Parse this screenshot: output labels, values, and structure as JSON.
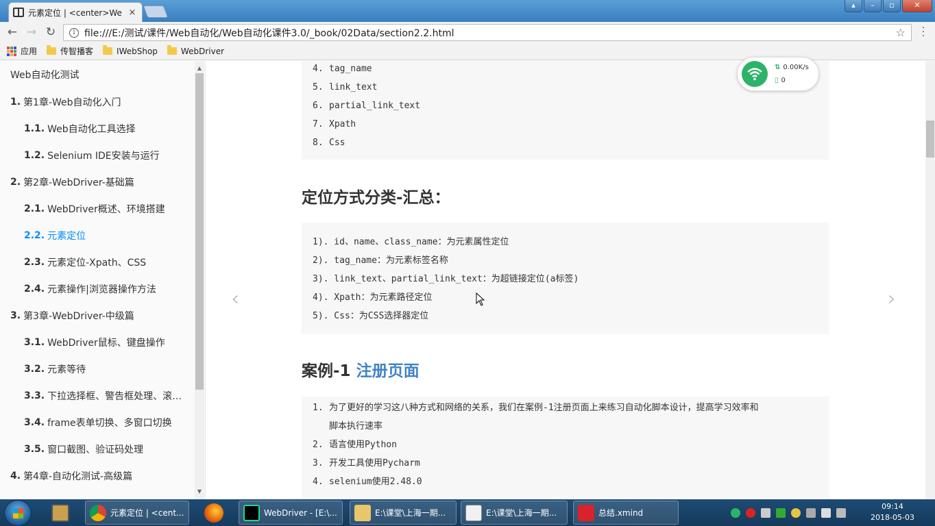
{
  "browser": {
    "tab_title": "元素定位 | <center>We",
    "url": "file:///E:/测试/课件/Web自动化/Web自动化课件3.0/_book/02Data/section2.2.html",
    "bookmarks": [
      "应用",
      "传智播客",
      "IWebShop",
      "WebDriver"
    ],
    "tab_close": "×"
  },
  "sidebar": {
    "book_title": "Web自动化测试",
    "items": [
      {
        "num": "1.",
        "label": "第1章-Web自动化入门",
        "level": 1
      },
      {
        "num": "1.1.",
        "label": "Web自动化工具选择",
        "level": 2
      },
      {
        "num": "1.2.",
        "label": "Selenium IDE安装与运行",
        "level": 2
      },
      {
        "num": "2.",
        "label": "第2章-WebDriver-基础篇",
        "level": 1
      },
      {
        "num": "2.1.",
        "label": "WebDriver概述、环境搭建",
        "level": 2
      },
      {
        "num": "2.2.",
        "label": "元素定位",
        "level": 2,
        "active": true
      },
      {
        "num": "2.3.",
        "label": "元素定位-Xpath、CSS",
        "level": 2
      },
      {
        "num": "2.4.",
        "label": "元素操作|浏览器操作方法",
        "level": 2
      },
      {
        "num": "3.",
        "label": "第3章-WebDriver-中级篇",
        "level": 1
      },
      {
        "num": "3.1.",
        "label": "WebDriver鼠标、键盘操作",
        "level": 2
      },
      {
        "num": "3.2.",
        "label": "元素等待",
        "level": 2
      },
      {
        "num": "3.3.",
        "label": "下拉选择框、警告框处理、滚…",
        "level": 2
      },
      {
        "num": "3.4.",
        "label": "frame表单切换、多窗口切换",
        "level": 2
      },
      {
        "num": "3.5.",
        "label": "窗口截图、验证码处理",
        "level": 2
      },
      {
        "num": "4.",
        "label": "第4章-自动化测试-高级篇",
        "level": 1
      }
    ]
  },
  "content": {
    "list1": [
      {
        "n": "4.",
        "t": "tag_name"
      },
      {
        "n": "5.",
        "t": "link_text"
      },
      {
        "n": "6.",
        "t": "partial_link_text"
      },
      {
        "n": "7.",
        "t": "Xpath"
      },
      {
        "n": "8.",
        "t": "Css"
      }
    ],
    "heading1": "定位方式分类-汇总：",
    "summary": [
      "1). id、name、class_name：为元素属性定位",
      "2). tag_name：为元素标签名称",
      "3). link_text、partial_link_text：为超链接定位(a标签)",
      "4). Xpath：为元素路径定位",
      "5). Css：为CSS选择器定位"
    ],
    "heading2_prefix": "案例-1 ",
    "heading2_link": "注册页面",
    "list2": [
      {
        "n": "1.",
        "t": "为了更好的学习这八种方式和网络的关系，我们在案例-1注册页面上来练习自动化脚本设计，提高学习效率和"
      },
      {
        "n": "",
        "t": "脚本执行速率"
      },
      {
        "n": "2.",
        "t": "语言使用Python"
      },
      {
        "n": "3.",
        "t": "开发工具使用Pycharm"
      },
      {
        "n": "4.",
        "t": "selenium使用2.48.0"
      }
    ],
    "prev_arrow": "‹",
    "next_arrow": "›"
  },
  "network_widget": {
    "speed": "0.00K/s",
    "count": "0"
  },
  "taskbar": {
    "tasks": [
      "元素定位 | <cent...",
      "WebDriver - [E:\\...",
      "E:\\课堂\\上海一期...",
      "E:\\课堂\\上海一期...",
      "总结.xmind"
    ],
    "time": "09:14",
    "date": "2018-05-03"
  },
  "colors": {
    "active_link": "#008cff",
    "heading_link": "#4183c4",
    "wifi_green": "#2db369"
  }
}
